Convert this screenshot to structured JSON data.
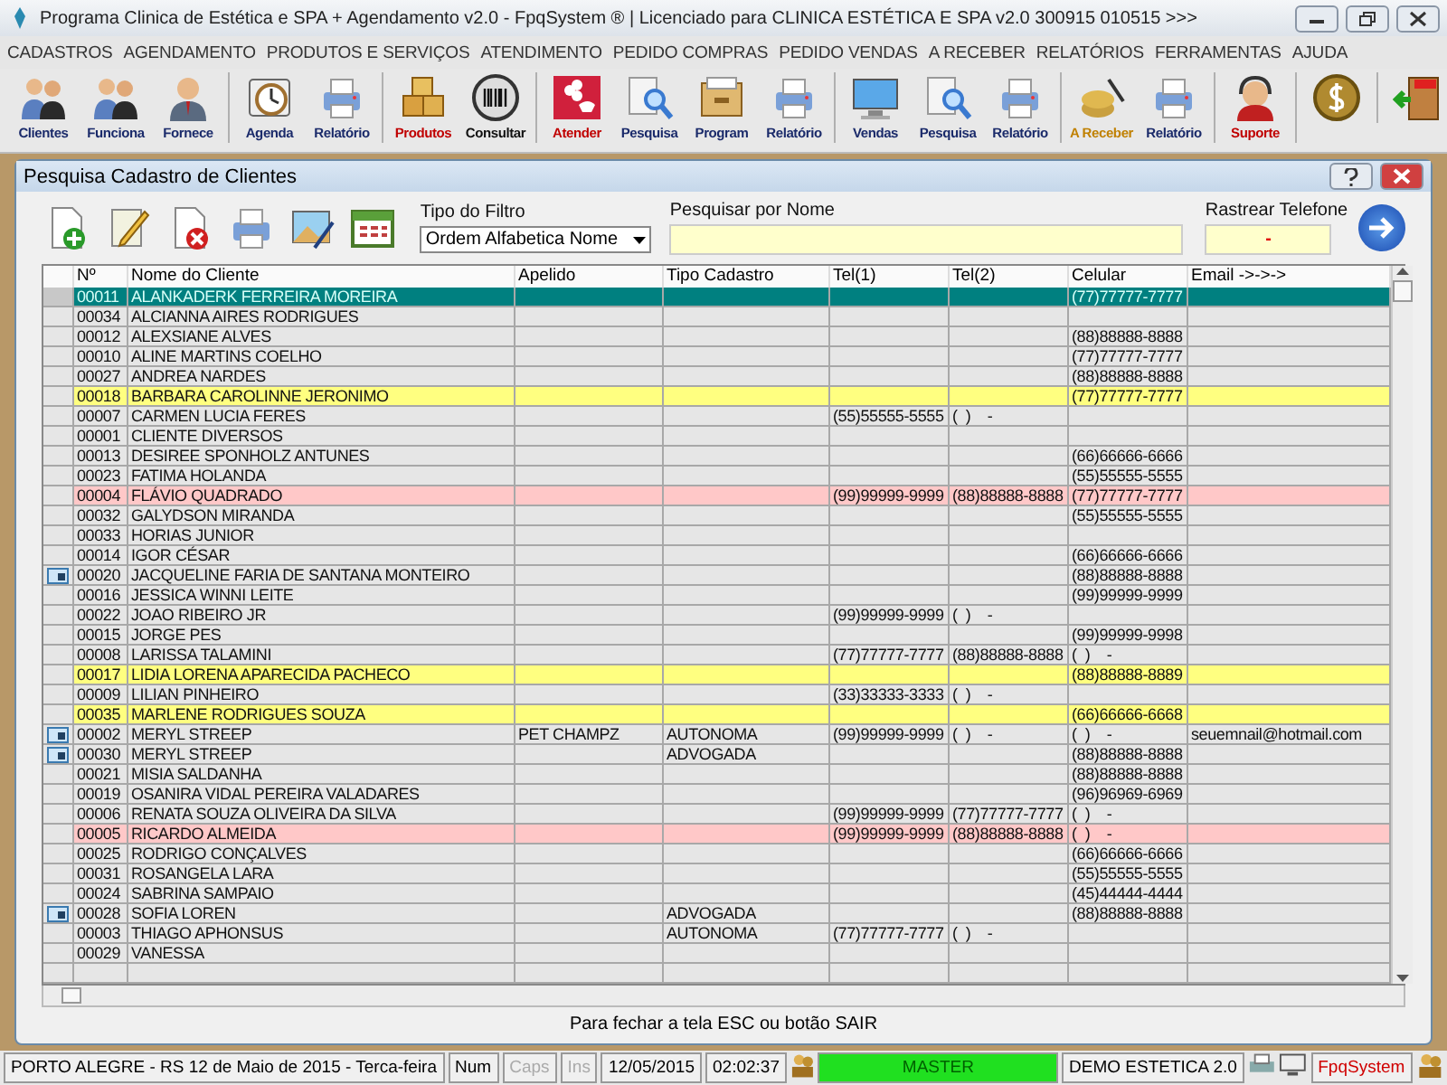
{
  "window": {
    "title": "Programa Clinica de Estética e SPA + Agendamento v2.0 - FpqSystem ® | Licenciado para  CLINICA ESTÉTICA E SPA v2.0 300915 010515 >>>"
  },
  "menu": [
    "CADASTROS",
    "AGENDAMENTO",
    "PRODUTOS E SERVIÇOS",
    "ATENDIMENTO",
    "PEDIDO COMPRAS",
    "PEDIDO VENDAS",
    "A RECEBER",
    "RELATÓRIOS",
    "FERRAMENTAS",
    "AJUDA"
  ],
  "toolbar": [
    {
      "buttons": [
        {
          "kind": "people",
          "label": "Clientes",
          "color": "#1a2a6a"
        },
        {
          "kind": "people",
          "label": "Funciona",
          "color": "#1a2a6a"
        },
        {
          "kind": "person",
          "label": "Fornece",
          "color": "#1a2a6a"
        }
      ]
    },
    {
      "buttons": [
        {
          "kind": "clock",
          "label": "Agenda",
          "color": "#1a2a6a"
        },
        {
          "kind": "printer",
          "label": "Relatório",
          "color": "#1a2a6a"
        }
      ]
    },
    {
      "buttons": [
        {
          "kind": "boxes",
          "label": "Produtos",
          "color": "#c00000"
        },
        {
          "kind": "barcode",
          "label": "Consultar",
          "color": "#111111"
        }
      ]
    },
    {
      "buttons": [
        {
          "kind": "flower",
          "label": "Atender",
          "color": "#c00000"
        },
        {
          "kind": "search",
          "label": "Pesquisa",
          "color": "#1a2a6a"
        },
        {
          "kind": "drawer",
          "label": "Program",
          "color": "#1a2a6a"
        },
        {
          "kind": "printer",
          "label": "Relatório",
          "color": "#1a2a6a"
        }
      ]
    },
    {
      "buttons": [
        {
          "kind": "monitor",
          "label": "Vendas",
          "color": "#1a2a6a"
        },
        {
          "kind": "search",
          "label": "Pesquisa",
          "color": "#1a2a6a"
        },
        {
          "kind": "printer",
          "label": "Relatório",
          "color": "#1a2a6a"
        }
      ]
    },
    {
      "buttons": [
        {
          "kind": "money",
          "label": "A Receber",
          "color": "#c08000"
        },
        {
          "kind": "printer",
          "label": "Relatório",
          "color": "#1a2a6a"
        }
      ]
    },
    {
      "buttons": [
        {
          "kind": "headset",
          "label": "Suporte",
          "color": "#c00000"
        }
      ]
    },
    {
      "buttons": [
        {
          "kind": "coin"
        }
      ]
    },
    {
      "buttons": [
        {
          "kind": "exit"
        }
      ]
    }
  ],
  "dialog": {
    "title": "Pesquisa Cadastro de Clientes",
    "tools": [
      {
        "kind": "new"
      },
      {
        "kind": "edit"
      },
      {
        "kind": "delete"
      },
      {
        "kind": "print"
      },
      {
        "kind": "picture"
      },
      {
        "kind": "calendar"
      }
    ],
    "filter": {
      "label": "Tipo do Filtro",
      "value": "Ordem Alfabetica Nome"
    },
    "search": {
      "label": "Pesquisar por Nome"
    },
    "phone": {
      "label": "Rastrear Telefone",
      "value": "-"
    },
    "columns": [
      "Nº",
      "Nome do Cliente",
      "Apelido",
      "Tipo Cadastro",
      "Tel(1)",
      "Tel(2)",
      "Celular",
      "Email ->->->"
    ],
    "rows": [
      {
        "no": "00011",
        "name": "ALANKADERK FERREIRA MOREIRA",
        "cel": "(77)77777-7777",
        "selected": true,
        "card": false,
        "color": "#008080"
      },
      {
        "no": "00034",
        "name": "ALCIANNA AIRES RODRIGUES",
        "selected": false,
        "card": false,
        "color": "#e6e6e6"
      },
      {
        "no": "00012",
        "name": "ALEXSIANE ALVES",
        "cel": "(88)88888-8888",
        "selected": false,
        "card": false,
        "color": "#e6e6e6"
      },
      {
        "no": "00010",
        "name": "ALINE MARTINS COELHO",
        "cel": "(77)77777-7777",
        "selected": false,
        "card": false,
        "color": "#e6e6e6"
      },
      {
        "no": "00027",
        "name": "ANDREA NARDES",
        "cel": "(88)88888-8888",
        "selected": false,
        "card": false,
        "color": "#e6e6e6"
      },
      {
        "no": "00018",
        "name": "BARBARA CAROLINNE JERONIMO",
        "cel": "(77)77777-7777",
        "selected": false,
        "card": false,
        "color": "#ffff80"
      },
      {
        "no": "00007",
        "name": "CARMEN LUCIA FERES",
        "tel1": "(55)55555-5555",
        "tel2": "(  )    -",
        "selected": false,
        "card": false,
        "color": "#e6e6e6"
      },
      {
        "no": "00001",
        "name": "CLIENTE DIVERSOS",
        "selected": false,
        "card": false,
        "color": "#e6e6e6"
      },
      {
        "no": "00013",
        "name": "DESIREE SPONHOLZ ANTUNES",
        "cel": "(66)66666-6666",
        "selected": false,
        "card": false,
        "color": "#e6e6e6"
      },
      {
        "no": "00023",
        "name": "FATIMA HOLANDA",
        "cel": "(55)55555-5555",
        "selected": false,
        "card": false,
        "color": "#e6e6e6"
      },
      {
        "no": "00004",
        "name": "FLÁVIO QUADRADO",
        "tel1": "(99)99999-9999",
        "tel2": "(88)88888-8888",
        "cel": "(77)77777-7777",
        "selected": false,
        "card": false,
        "color": "#ffc8c8"
      },
      {
        "no": "00032",
        "name": "GALYDSON MIRANDA",
        "cel": "(55)55555-5555",
        "selected": false,
        "card": false,
        "color": "#e6e6e6"
      },
      {
        "no": "00033",
        "name": "HORIAS JUNIOR",
        "selected": false,
        "card": false,
        "color": "#e6e6e6"
      },
      {
        "no": "00014",
        "name": "IGOR CÉSAR",
        "cel": "(66)66666-6666",
        "selected": false,
        "card": false,
        "color": "#e6e6e6"
      },
      {
        "no": "00020",
        "name": "JACQUELINE FARIA DE SANTANA MONTEIRO",
        "cel": "(88)88888-8888",
        "selected": false,
        "card": true,
        "color": "#e6e6e6"
      },
      {
        "no": "00016",
        "name": "JESSICA WINNI LEITE",
        "cel": "(99)99999-9999",
        "selected": false,
        "card": false,
        "color": "#e6e6e6"
      },
      {
        "no": "00022",
        "name": "JOAO RIBEIRO JR",
        "tel1": "(99)99999-9999",
        "tel2": "(  )    -",
        "selected": false,
        "card": false,
        "color": "#e6e6e6"
      },
      {
        "no": "00015",
        "name": "JORGE PES",
        "cel": "(99)99999-9998",
        "selected": false,
        "card": false,
        "color": "#e6e6e6"
      },
      {
        "no": "00008",
        "name": "LARISSA TALAMINI",
        "tel1": "(77)77777-7777",
        "tel2": "(88)88888-8888",
        "cel": "(  )    -",
        "selected": false,
        "card": false,
        "color": "#e6e6e6"
      },
      {
        "no": "00017",
        "name": "LIDIA LORENA APARECIDA PACHECO",
        "cel": "(88)88888-8889",
        "selected": false,
        "card": false,
        "color": "#ffff80"
      },
      {
        "no": "00009",
        "name": "LILIAN PINHEIRO",
        "tel1": "(33)33333-3333",
        "tel2": "(  )    -",
        "selected": false,
        "card": false,
        "color": "#e6e6e6"
      },
      {
        "no": "00035",
        "name": "MARLENE RODRIGUES SOUZA",
        "cel": "(66)66666-6668",
        "selected": false,
        "card": false,
        "color": "#ffff80"
      },
      {
        "no": "00002",
        "name": "MERYL STREEP",
        "nick": "PET CHAMPZ",
        "type": "AUTONOMA",
        "tel1": "(99)99999-9999",
        "tel2": "(  )    -",
        "cel": "(  )    -",
        "email": "seuemnail@hotmail.com",
        "selected": false,
        "card": true,
        "color": "#e6e6e6"
      },
      {
        "no": "00030",
        "name": "MERYL STREEP",
        "type": "ADVOGADA",
        "cel": "(88)88888-8888",
        "selected": false,
        "card": true,
        "color": "#e6e6e6"
      },
      {
        "no": "00021",
        "name": "MISIA SALDANHA",
        "cel": "(88)88888-8888",
        "selected": false,
        "card": false,
        "color": "#e6e6e6"
      },
      {
        "no": "00019",
        "name": "OSANIRA VIDAL PEREIRA VALADARES",
        "cel": "(96)96969-6969",
        "selected": false,
        "card": false,
        "color": "#e6e6e6"
      },
      {
        "no": "00006",
        "name": "RENATA SOUZA OLIVEIRA DA SILVA",
        "tel1": "(99)99999-9999",
        "tel2": "(77)77777-7777",
        "cel": "(  )    -",
        "selected": false,
        "card": false,
        "color": "#e6e6e6"
      },
      {
        "no": "00005",
        "name": "RICARDO ALMEIDA",
        "tel1": "(99)99999-9999",
        "tel2": "(88)88888-8888",
        "cel": "(  )    -",
        "selected": false,
        "card": false,
        "color": "#ffc8c8"
      },
      {
        "no": "00025",
        "name": "RODRIGO CONÇALVES",
        "cel": "(66)66666-6666",
        "selected": false,
        "card": false,
        "color": "#e6e6e6"
      },
      {
        "no": "00031",
        "name": "ROSANGELA LARA",
        "cel": "(55)55555-5555",
        "selected": false,
        "card": false,
        "color": "#e6e6e6"
      },
      {
        "no": "00024",
        "name": "SABRINA SAMPAIO",
        "cel": "(45)44444-4444",
        "selected": false,
        "card": false,
        "color": "#e6e6e6"
      },
      {
        "no": "00028",
        "name": "SOFIA LOREN",
        "type": "ADVOGADA",
        "cel": "(88)88888-8888",
        "selected": false,
        "card": true,
        "color": "#e6e6e6"
      },
      {
        "no": "00003",
        "name": "THIAGO APHONSUS",
        "type": "AUTONOMA",
        "tel1": "(77)77777-7777",
        "tel2": "(  )    -",
        "selected": false,
        "card": false,
        "color": "#e6e6e6"
      },
      {
        "no": "00029",
        "name": "VANESSA",
        "selected": false,
        "card": false,
        "color": "#e6e6e6"
      }
    ],
    "hint": "Para fechar a tela ESC ou botão SAIR"
  },
  "status_bar": [
    {
      "kind": "text",
      "text": "PORTO ALEGRE - RS 12 de Maio de 2015 - Terca-feira",
      "disabled": false
    },
    {
      "kind": "key",
      "text": "Num",
      "disabled": false
    },
    {
      "kind": "key",
      "text": "Caps",
      "disabled": true
    },
    {
      "kind": "key",
      "text": "Ins",
      "disabled": true
    },
    {
      "kind": "text",
      "text": "12/05/2015",
      "disabled": false
    },
    {
      "kind": "text",
      "text": "02:02:37",
      "disabled": false
    },
    {
      "kind": "user",
      "text": "MASTER",
      "disabled": false
    },
    {
      "kind": "db",
      "text": "DEMO ESTETICA 2.0",
      "disabled": false
    },
    {
      "kind": "icon"
    },
    {
      "kind": "brand",
      "text": "FpqSystem",
      "disabled": false
    },
    {
      "kind": "usericon"
    }
  ]
}
